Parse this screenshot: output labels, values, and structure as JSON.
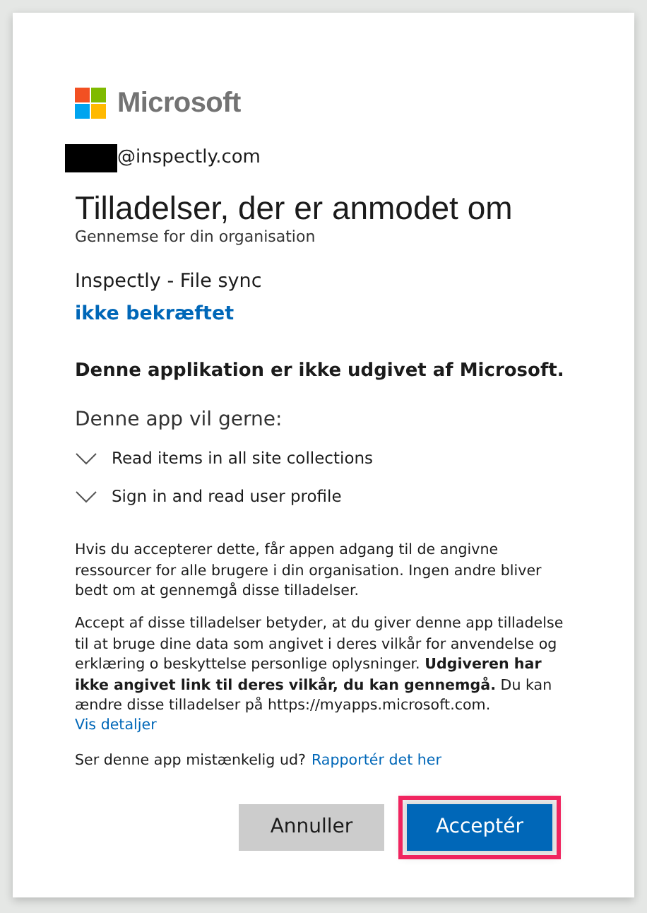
{
  "logo": {
    "text": "Microsoft"
  },
  "account": {
    "redacted": true,
    "email": "@inspectly.com"
  },
  "title": "Tilladelser, der er anmodet om",
  "subtitle": "Gennemse for din organisation",
  "app": {
    "name": "Inspectly - File sync",
    "verification": "ikke bekræftet"
  },
  "publisher_notice": "Denne applikation er ikke udgivet af Microsoft.",
  "permissions_heading": "Denne app vil gerne:",
  "permissions": [
    {
      "label": "Read items in all site collections",
      "expanded": false
    },
    {
      "label": "Sign in and read user profile",
      "expanded": false
    }
  ],
  "paragraphs": [
    {
      "text": "Hvis du accepterer dette, får appen adgang til de angivne ressourcer for alle brugere i din organisation. Ingen andre bliver bedt om at gennemgå disse tilladelser."
    },
    {
      "text": "Accept af disse tilladelser betyder, at du giver denne app tilladelse til at bruge dine data som angivet i deres vilkår for anvendelse og erklæring o beskyttelse personlige oplysninger. **Udgiveren har ikke angivet link til deres vilkår, du kan gennemgå.** Du kan ændre disse tilladelser på https://myapps.microsoft.com.",
      "link": "Vis detaljer"
    }
  ],
  "report": {
    "text": "Ser denne app mistænkelig ud?",
    "link": "Rapportér det her"
  },
  "buttons": [
    {
      "label": "Annuller",
      "kind": "secondary",
      "highlighted": false
    },
    {
      "label": "Acceptér",
      "kind": "primary",
      "highlighted": true
    }
  ]
}
